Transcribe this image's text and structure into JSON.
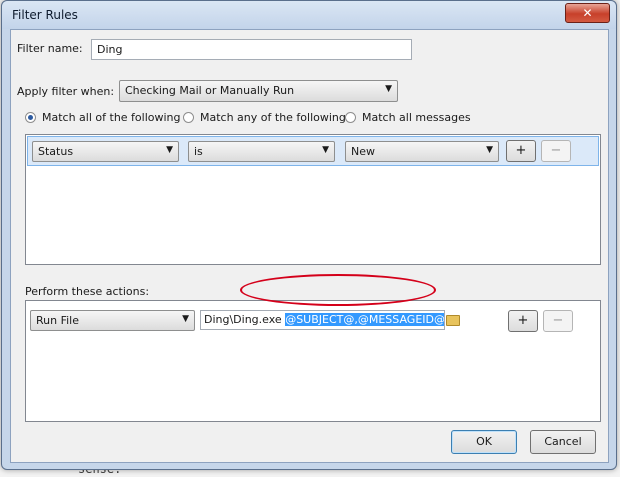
{
  "window": {
    "title": "Filter Rules",
    "close_glyph": "✕"
  },
  "filter_name": {
    "label": "Filter name:",
    "value": "Ding"
  },
  "apply_when": {
    "label": "Apply filter when:",
    "value": "Checking Mail or Manually Run"
  },
  "match_options": [
    {
      "label": "Match all of the following",
      "selected": true
    },
    {
      "label": "Match any of the following",
      "selected": false
    },
    {
      "label": "Match all messages",
      "selected": false
    }
  ],
  "rule": {
    "field": "Status",
    "operator": "is",
    "value": "New",
    "add_glyph": "+",
    "remove_glyph": "−"
  },
  "actions": {
    "label": "Perform these actions:",
    "action": "Run File",
    "path_plain": "Ding\\Ding.exe ",
    "path_selected": "@SUBJECT@,@MESSAGEID@",
    "add_glyph": "+",
    "remove_glyph": "−"
  },
  "buttons": {
    "ok": "OK",
    "cancel": "Cancel"
  },
  "background_fragment": "sense."
}
